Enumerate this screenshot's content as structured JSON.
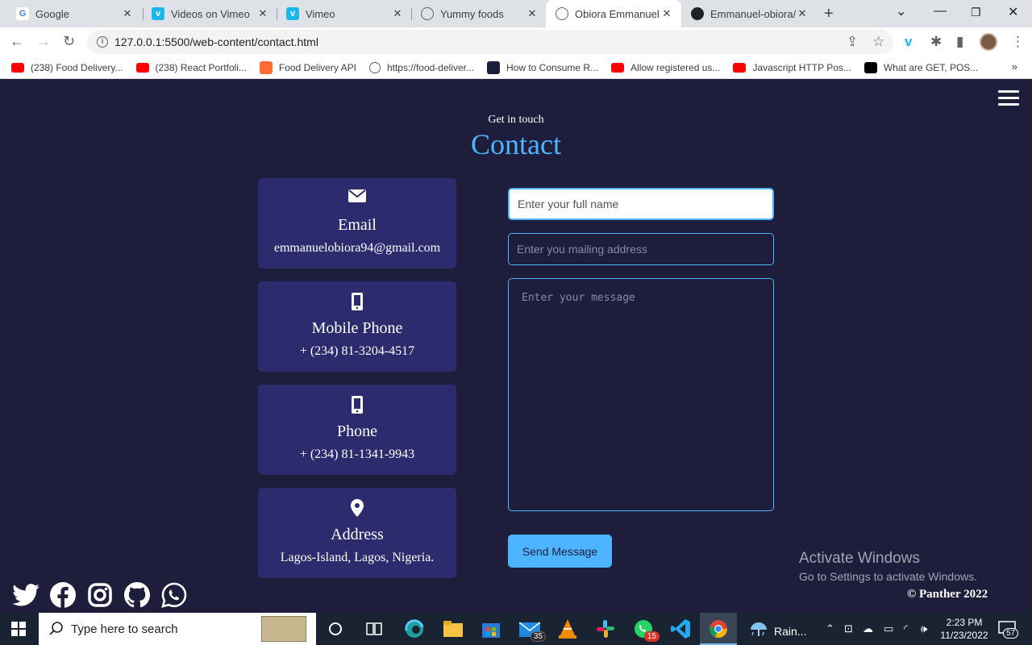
{
  "browser": {
    "tabs": [
      {
        "label": "Google",
        "favicon": "google-icon",
        "color": "#4285f4"
      },
      {
        "label": "Videos on Vimeo",
        "favicon": "vimeo-icon",
        "color": "#1ab7ea"
      },
      {
        "label": "Vimeo",
        "favicon": "vimeo-icon",
        "color": "#1ab7ea"
      },
      {
        "label": "Yummy foods",
        "favicon": "globe-icon",
        "color": "#5f6368"
      },
      {
        "label": "Obiora Emmanuel I",
        "favicon": "globe-icon",
        "color": "#5f6368",
        "active": true
      },
      {
        "label": "Emmanuel-obiora/",
        "favicon": "github-icon",
        "color": "#202124"
      }
    ],
    "url": "127.0.0.1:5500/web-content/contact.html",
    "bookmarks": [
      {
        "label": "(238) Food Delivery...",
        "icon": "youtube-icon",
        "color": "#ff0000"
      },
      {
        "label": "(238) React Portfoli...",
        "icon": "youtube-icon",
        "color": "#ff0000"
      },
      {
        "label": "Food Delivery API",
        "icon": "postman-icon",
        "color": "#ff6c37"
      },
      {
        "label": "https://food-deliver...",
        "icon": "globe-icon",
        "color": "#5f6368"
      },
      {
        "label": "How to Consume R...",
        "icon": "logo-icon",
        "color": "#1b1f3b"
      },
      {
        "label": "Allow registered us...",
        "icon": "youtube-icon",
        "color": "#ff0000"
      },
      {
        "label": "Javascript HTTP Pos...",
        "icon": "youtube-icon",
        "color": "#ff0000"
      },
      {
        "label": "What are GET, POS...",
        "icon": "medium-icon",
        "color": "#000000"
      }
    ]
  },
  "page": {
    "subtitle": "Get in touch",
    "title": "Contact",
    "cards": [
      {
        "title": "Email",
        "value": "emmanuelobiora94@gmail.com",
        "icon": "envelope-icon"
      },
      {
        "title": "Mobile Phone",
        "value": "+ (234) 81-3204-4517",
        "icon": "mobile-icon"
      },
      {
        "title": "Phone",
        "value": "+ (234) 81-1341-9943",
        "icon": "mobile-icon"
      },
      {
        "title": "Address",
        "value": "Lagos-Island, Lagos, Nigeria.",
        "icon": "location-pin-icon"
      }
    ],
    "form": {
      "name_placeholder": "Enter your full name",
      "email_placeholder": "Enter you mailing address",
      "message_placeholder": "Enter your message",
      "submit_label": "Send Message"
    },
    "socials": [
      "twitter-icon",
      "facebook-icon",
      "instagram-icon",
      "github-icon",
      "whatsapp-icon"
    ],
    "copyright": "© Panther 2022",
    "activate_title": "Activate Windows",
    "activate_sub": "Go to Settings to activate Windows.",
    "colors": {
      "accent": "#4db5ff",
      "background": "#1e1e3c",
      "card": "#2c2b6e"
    }
  },
  "taskbar": {
    "search_placeholder": "Type here to search",
    "mail_badge": "35",
    "whatsapp_badge": "15",
    "weather": "Rain...",
    "time": "2:23 PM",
    "date": "11/23/2022",
    "notifications": "57"
  }
}
